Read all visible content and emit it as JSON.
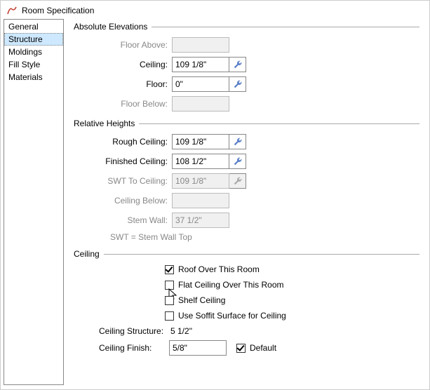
{
  "window": {
    "title": "Room Specification"
  },
  "sidebar": {
    "items": [
      {
        "label": "General"
      },
      {
        "label": "Structure"
      },
      {
        "label": "Moldings"
      },
      {
        "label": "Fill Style"
      },
      {
        "label": "Materials"
      }
    ]
  },
  "abs": {
    "title": "Absolute Elevations",
    "floor_above_label": "Floor Above:",
    "floor_above_value": "",
    "ceiling_label": "Ceiling:",
    "ceiling_value": "109 1/8\"",
    "floor_label": "Floor:",
    "floor_value": "0\"",
    "floor_below_label": "Floor Below:",
    "floor_below_value": ""
  },
  "rel": {
    "title": "Relative Heights",
    "rough_ceiling_label": "Rough Ceiling:",
    "rough_ceiling_value": "109 1/8\"",
    "finished_ceiling_label": "Finished Ceiling:",
    "finished_ceiling_value": "108 1/2\"",
    "swt_label": "SWT To Ceiling:",
    "swt_value": "109 1/8\"",
    "ceiling_below_label": "Ceiling Below:",
    "ceiling_below_value": "",
    "stem_wall_label": "Stem Wall:",
    "stem_wall_value": "37 1/2\"",
    "note": "SWT = Stem Wall Top"
  },
  "ceiling": {
    "title": "Ceiling",
    "roof_over_label": "Roof Over This Room",
    "flat_ceiling_label": "Flat Ceiling Over This Room",
    "shelf_ceiling_label": "Shelf Ceiling",
    "soffit_label": "Use Soffit Surface for Ceiling",
    "structure_label": "Ceiling Structure:",
    "structure_value": "5 1/2\"",
    "finish_label": "Ceiling Finish:",
    "finish_value": "5/8\"",
    "default_label": "Default"
  }
}
